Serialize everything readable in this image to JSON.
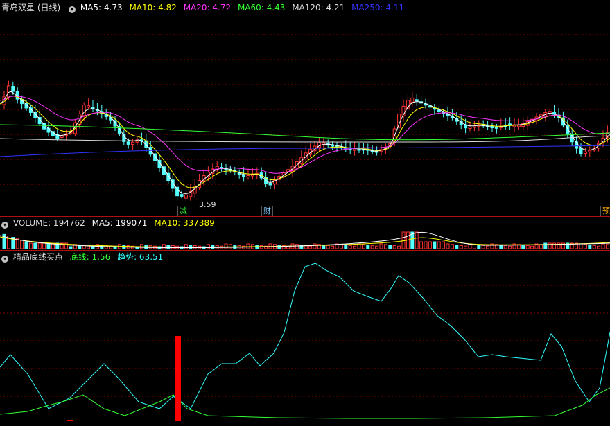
{
  "panel_main": {
    "title": "青岛双星 (日线)",
    "ma": [
      {
        "label": "MA5: 4.73",
        "color": "#ffffff"
      },
      {
        "label": "MA10: 4.82",
        "color": "#ffff00"
      },
      {
        "label": "MA20: 4.72",
        "color": "#ff33ff"
      },
      {
        "label": "MA60: 4.43",
        "color": "#33ff33"
      },
      {
        "label": "MA120: 4.21",
        "color": "#dddddd"
      },
      {
        "label": "MA250: 4.11",
        "color": "#3333ff"
      }
    ],
    "low_marker": "3.59",
    "badges": [
      "减",
      "财",
      "预"
    ]
  },
  "panel_volume": {
    "labels": [
      {
        "label": "VOLUME: 194762",
        "color": "#dddddd"
      },
      {
        "label": "MA5: 199071",
        "color": "#ffffff"
      },
      {
        "label": "MA10: 337389",
        "color": "#ffff00"
      }
    ]
  },
  "panel_indicator": {
    "title": "精品底线买点",
    "labels": [
      {
        "label": "底线: 1.56",
        "color": "#33ff33"
      },
      {
        "label": "趋势: 63.51",
        "color": "#33ffff"
      }
    ]
  },
  "colors": {
    "up": "#ff3333",
    "down": "#54ffff",
    "grid": "#8b0000"
  }
}
